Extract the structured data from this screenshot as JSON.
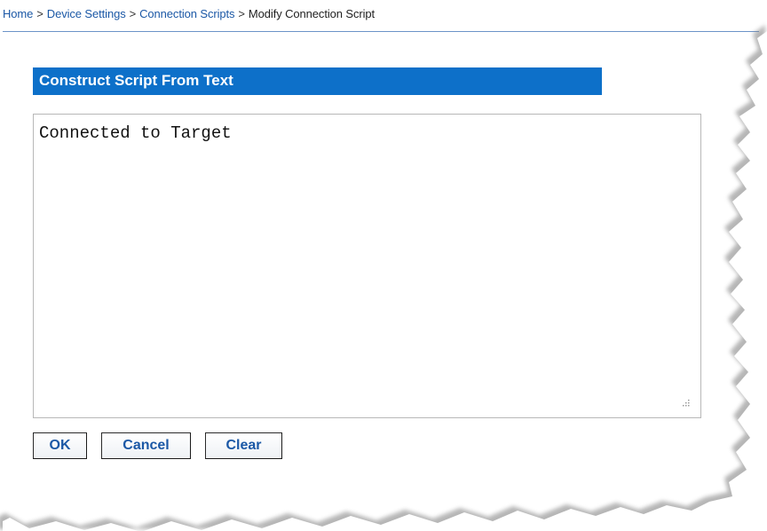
{
  "breadcrumb": {
    "items": [
      {
        "label": "Home"
      },
      {
        "label": "Device Settings"
      },
      {
        "label": "Connection Scripts"
      }
    ],
    "separator": ">",
    "current": "Modify Connection Script"
  },
  "section": {
    "title": "Construct Script From Text"
  },
  "script_editor": {
    "value": "Connected to Target",
    "placeholder": ""
  },
  "buttons": {
    "ok": "OK",
    "cancel": "Cancel",
    "clear": "Clear"
  },
  "colors": {
    "link": "#1b58a6",
    "header_bg": "#0d70c9",
    "header_text": "#ffffff",
    "rule": "#6c93c8"
  }
}
